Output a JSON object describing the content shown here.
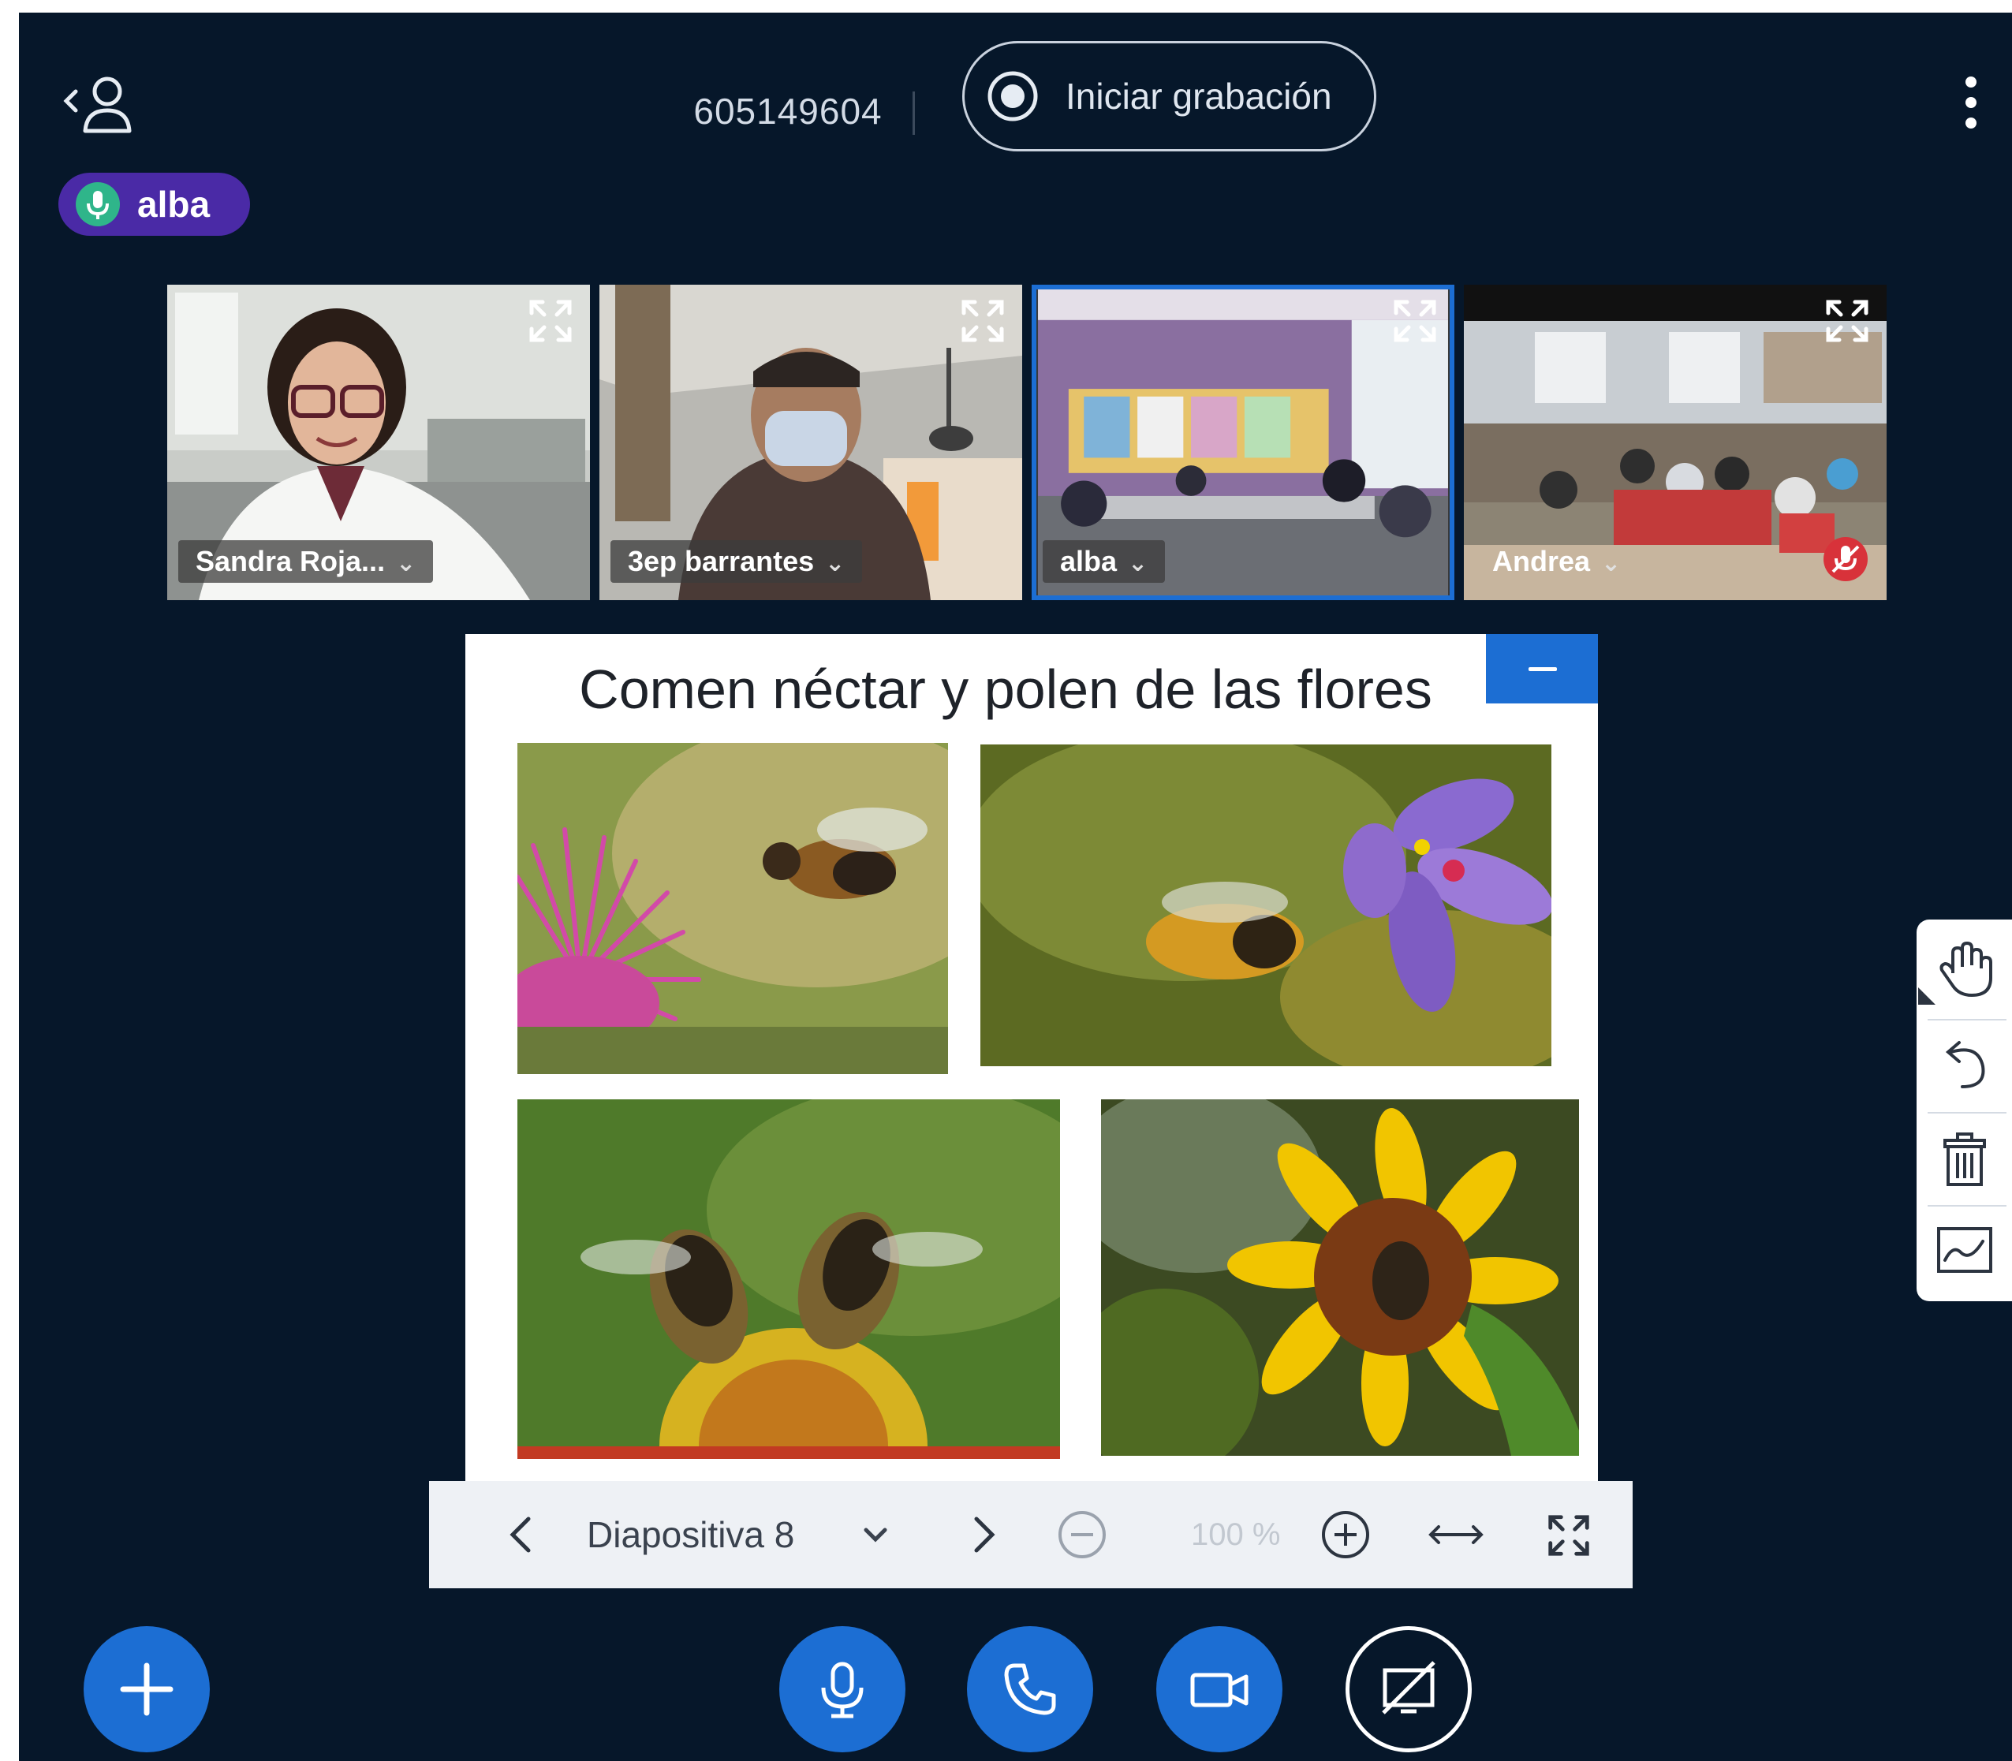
{
  "header": {
    "meeting_id": "605149604",
    "record_label": "Iniciar grabación",
    "icons": [
      "user-list-icon",
      "record-icon",
      "more-options-icon"
    ]
  },
  "talking_indicator": {
    "name": "alba",
    "icon": "microphone-icon"
  },
  "participants": [
    {
      "name": "Sandra Roja...",
      "icon": "chevron-down-icon"
    },
    {
      "name": "3ep barrantes",
      "icon": "chevron-down-icon"
    },
    {
      "name": "alba",
      "icon": "chevron-down-icon",
      "speaking": true
    },
    {
      "name": "Andrea",
      "icon": "chevron-down-icon",
      "muted": true
    }
  ],
  "presentation": {
    "slide_title": "Comen néctar y polen de las flores",
    "slide_label": "Diapositiva 8",
    "zoom": "100 %",
    "icons": [
      "previous-slide-icon",
      "chevron-down-icon",
      "next-slide-icon",
      "zoom-out-icon",
      "zoom-in-icon",
      "fit-width-icon",
      "fullscreen-icon",
      "minimize-icon"
    ]
  },
  "whiteboard_tools": [
    "hand-pan-icon",
    "undo-icon",
    "trash-icon",
    "multi-user-whiteboard-icon"
  ],
  "bottom_bar": {
    "actions": [
      "plus-icon"
    ],
    "controls": [
      "microphone-icon",
      "phone-icon",
      "camera-icon",
      "screen-share-off-icon"
    ]
  },
  "colors": {
    "background": "#06172a",
    "primary": "#1c6ed3",
    "talking_badge": "#4a2aa6",
    "speaking_border": "#1c6ed3",
    "muted_badge": "#d8323a"
  }
}
